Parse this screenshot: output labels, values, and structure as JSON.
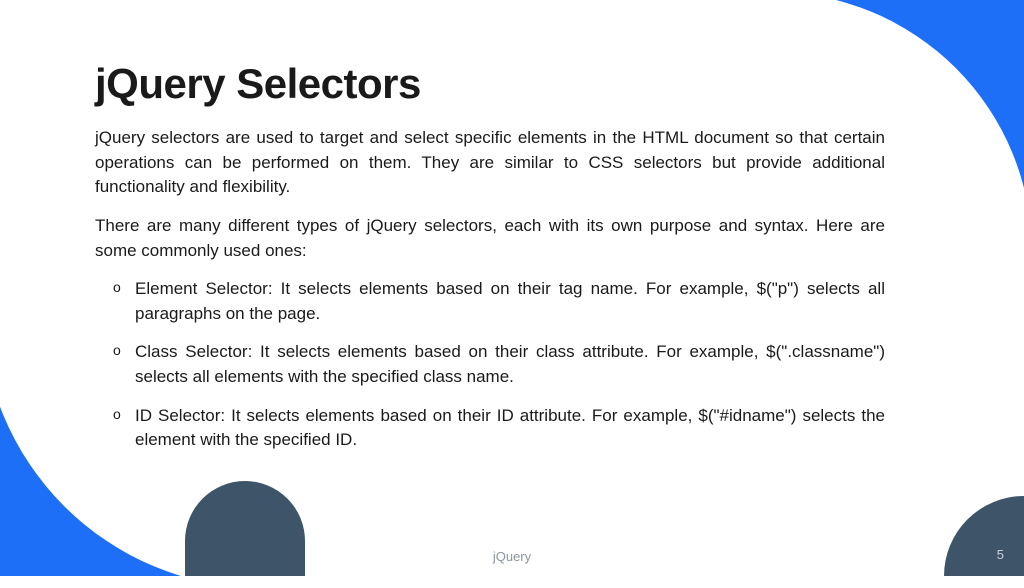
{
  "title": "jQuery Selectors",
  "paragraph1": "jQuery selectors are used to target and select specific elements in the HTML document so that certain operations can be performed on them. They are similar to CSS selectors but provide additional functionality and flexibility.",
  "paragraph2": "There are many different types of jQuery selectors, each with its own purpose and syntax. Here are some commonly used ones:",
  "items": [
    "Element Selector: It selects elements based on their tag name. For example, $(\"p\") selects all paragraphs on the page.",
    "Class Selector: It selects elements based on their class attribute. For example, $(\".classname\") selects all elements with the specified class name.",
    "ID Selector: It selects elements based on their ID attribute. For example, $(\"#idname\") selects the element with the specified ID."
  ],
  "footer": {
    "label": "jQuery",
    "page": "5"
  }
}
